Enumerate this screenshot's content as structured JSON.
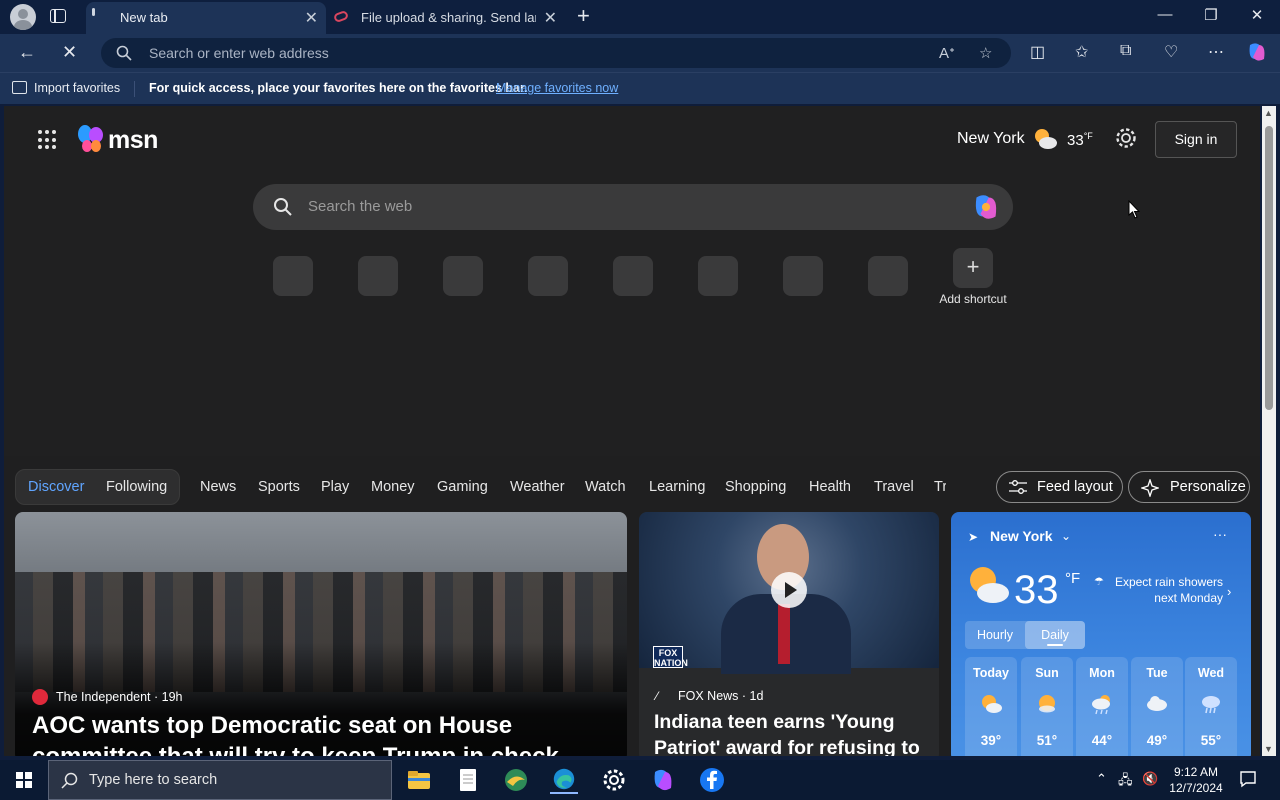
{
  "browser": {
    "tabs": [
      {
        "label": "New tab",
        "active": true
      },
      {
        "label": "File upload & sharing. Send large",
        "active": false
      }
    ],
    "address_placeholder": "Search or enter web address",
    "favorites_bar": {
      "import_label": "Import favorites",
      "message": "For quick access, place your favorites here on the favorites bar.",
      "link": "Manage favorites now"
    }
  },
  "msn": {
    "logo_text": "msn",
    "location": "New York",
    "temperature": "33",
    "temp_unit": "°F",
    "sign_in": "Sign in",
    "search_placeholder": "Search the web",
    "add_shortcut": "Add shortcut",
    "shortcut_count": 8
  },
  "feed_nav": {
    "discover": "Discover",
    "following": "Following",
    "categories": [
      "News",
      "Sports",
      "Play",
      "Money",
      "Gaming",
      "Weather",
      "Watch",
      "Learning",
      "Shopping",
      "Health",
      "Travel",
      "Tr"
    ],
    "feed_layout": "Feed layout",
    "personalize": "Personalize"
  },
  "cards": {
    "main": {
      "source": "The Independent",
      "age": "19h",
      "title": "AOC wants top Democratic seat on House committee that will try to keep Trump in check during his"
    },
    "fox": {
      "badge": "FOX NATION",
      "source": "FOX News",
      "age": "1d",
      "title": "Indiana teen earns 'Young Patriot' award for refusing to"
    },
    "weather": {
      "location": "New York",
      "temperature": "33",
      "unit": "°F",
      "note": "Expect rain showers next Monday",
      "toggle_hourly": "Hourly",
      "toggle_daily": "Daily",
      "days": [
        {
          "name": "Today",
          "temp": "39°",
          "icon": "partly-cloudy-icon"
        },
        {
          "name": "Sun",
          "temp": "51°",
          "icon": "sunny-cloud-icon"
        },
        {
          "name": "Mon",
          "temp": "44°",
          "icon": "showers-icon"
        },
        {
          "name": "Tue",
          "temp": "49°",
          "icon": "cloudy-icon"
        },
        {
          "name": "Wed",
          "temp": "55°",
          "icon": "rain-icon"
        }
      ]
    }
  },
  "taskbar": {
    "search_placeholder": "Type here to search",
    "time": "9:12 AM",
    "date": "12/7/2024"
  },
  "colors": {
    "accent_link": "#6fb0ff",
    "discover_blue": "#60a5ff",
    "weather_card": "#3d86e0"
  }
}
